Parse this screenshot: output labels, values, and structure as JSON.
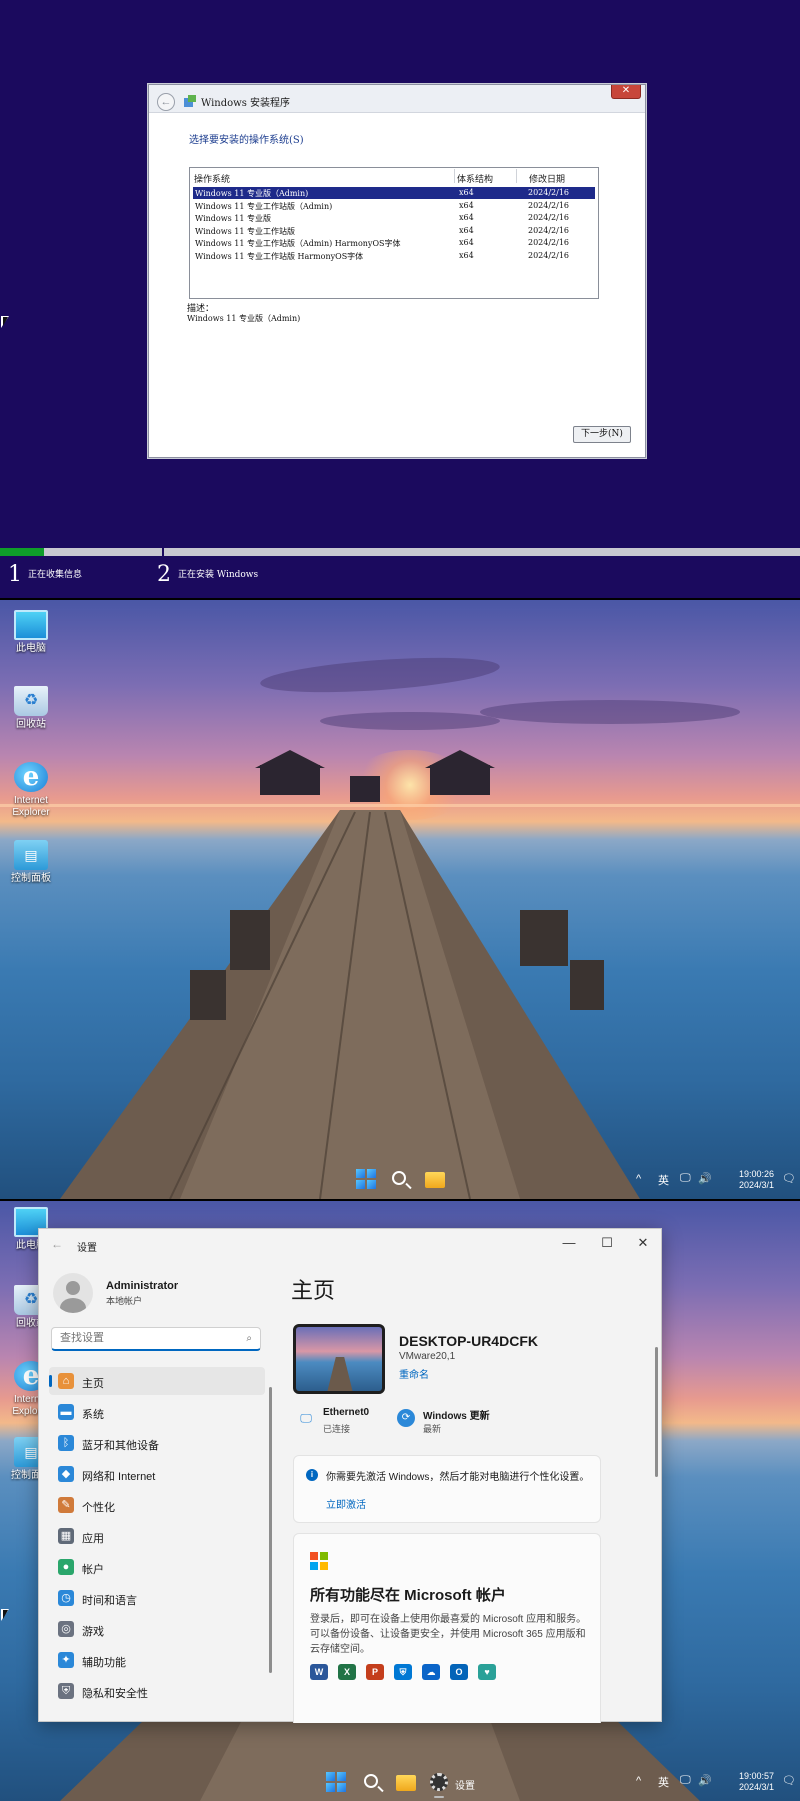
{
  "setup": {
    "window_title": "Windows 安装程序",
    "close_glyph": "✕",
    "prompt": "选择要安装的操作系统(S)",
    "columns": [
      "操作系统",
      "体系结构",
      "修改日期"
    ],
    "rows": [
      {
        "os": "Windows 11 专业版（Admin)",
        "arch": "x64",
        "date": "2024/2/16",
        "selected": true
      },
      {
        "os": "Windows 11 专业工作站版（Admin)",
        "arch": "x64",
        "date": "2024/2/16"
      },
      {
        "os": "Windows 11 专业版",
        "arch": "x64",
        "date": "2024/2/16"
      },
      {
        "os": "Windows 11 专业工作站版",
        "arch": "x64",
        "date": "2024/2/16"
      },
      {
        "os": "Windows 11 专业工作站版（Admin) HarmonyOS字体",
        "arch": "x64",
        "date": "2024/2/16"
      },
      {
        "os": "Windows 11 专业工作站版 HarmonyOS字体",
        "arch": "x64",
        "date": "2024/2/16"
      }
    ],
    "desc_label": "描述：",
    "desc_text": "Windows 11 专业版（Admin)",
    "next_button": "下一步(N)",
    "progress": 0.055,
    "steps": [
      {
        "num": "1",
        "label": "正在收集信息"
      },
      {
        "num": "2",
        "label": "正在安装 Windows"
      }
    ]
  },
  "desktop": {
    "icons": [
      {
        "label": "此电脑",
        "icon": "this-pc-icon"
      },
      {
        "label": "回收站",
        "icon": "recycle-bin-icon"
      },
      {
        "label": "Internet Explorer",
        "icon": "internet-explorer-icon"
      },
      {
        "label": "控制面板",
        "icon": "control-panel-icon"
      }
    ],
    "tray": {
      "chevron": "^",
      "ime": "英",
      "time": "19:00:26",
      "date": "2024/3/1"
    }
  },
  "settings": {
    "window_title": "设置",
    "controls": {
      "minimize": "—",
      "maximize": "☐",
      "close": "✕"
    },
    "user": {
      "name": "Administrator",
      "type": "本地帐户"
    },
    "search_placeholder": "查找设置",
    "nav": [
      {
        "label": "主页",
        "icon": "home-icon",
        "color": "#e8913a",
        "glyph": "⌂",
        "active": true
      },
      {
        "label": "系统",
        "icon": "system-icon",
        "color": "#2b88d8",
        "glyph": "▬"
      },
      {
        "label": "蓝牙和其他设备",
        "icon": "bluetooth-icon",
        "color": "#2b88d8",
        "glyph": "ᛒ"
      },
      {
        "label": "网络和 Internet",
        "icon": "network-icon",
        "color": "#2b88d8",
        "glyph": "◆"
      },
      {
        "label": "个性化",
        "icon": "personalization-icon",
        "color": "#d07a3a",
        "glyph": "✎"
      },
      {
        "label": "应用",
        "icon": "apps-icon",
        "color": "#606a78",
        "glyph": "▦"
      },
      {
        "label": "帐户",
        "icon": "accounts-icon",
        "color": "#2aa66b",
        "glyph": "●"
      },
      {
        "label": "时间和语言",
        "icon": "time-language-icon",
        "color": "#2b88d8",
        "glyph": "◷"
      },
      {
        "label": "游戏",
        "icon": "gaming-icon",
        "color": "#6b7280",
        "glyph": "◎"
      },
      {
        "label": "辅助功能",
        "icon": "accessibility-icon",
        "color": "#2b88d8",
        "glyph": "✦"
      },
      {
        "label": "隐私和安全性",
        "icon": "privacy-icon",
        "color": "#6b7280",
        "glyph": "⛨"
      }
    ],
    "page_title": "主页",
    "device": {
      "name": "DESKTOP-UR4DCFK",
      "model": "VMware20,1",
      "rename": "重命名"
    },
    "network": {
      "title": "Ethernet0",
      "status": "已连接"
    },
    "update": {
      "title": "Windows 更新",
      "status": "最新"
    },
    "activation": {
      "text": "你需要先激活 Windows，然后才能对电脑进行个性化设置。",
      "link": "立即激活"
    },
    "ms_account": {
      "title": "所有功能尽在 Microsoft 帐户",
      "body": "登录后，即可在设备上使用你最喜爱的 Microsoft 应用和服务。可以备份设备、让设备更安全，并使用 Microsoft 365 应用版和云存储空间。",
      "apps": [
        {
          "name": "word-icon",
          "letter": "W",
          "color": "#2b579a"
        },
        {
          "name": "excel-icon",
          "letter": "X",
          "color": "#217346"
        },
        {
          "name": "powerpoint-icon",
          "letter": "P",
          "color": "#c43e1c"
        },
        {
          "name": "defender-icon",
          "letter": "⛨",
          "color": "#0078d4"
        },
        {
          "name": "onedrive-icon",
          "letter": "☁",
          "color": "#0a64c8"
        },
        {
          "name": "outlook-icon",
          "letter": "O",
          "color": "#0364b8"
        },
        {
          "name": "family-icon",
          "letter": "♥",
          "color": "#2aa198"
        }
      ]
    },
    "taskbar_app_label": "设置",
    "tray": {
      "chevron": "^",
      "ime": "英",
      "time": "19:00:57",
      "date": "2024/3/1"
    }
  }
}
